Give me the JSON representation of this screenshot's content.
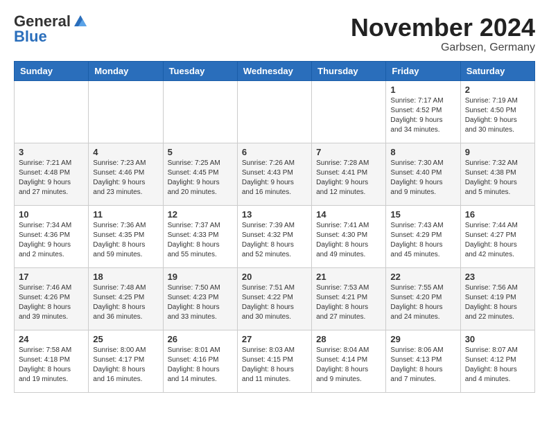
{
  "header": {
    "logo_general": "General",
    "logo_blue": "Blue",
    "month_title": "November 2024",
    "location": "Garbsen, Germany"
  },
  "weekdays": [
    "Sunday",
    "Monday",
    "Tuesday",
    "Wednesday",
    "Thursday",
    "Friday",
    "Saturday"
  ],
  "weeks": [
    [
      {
        "day": "",
        "info": ""
      },
      {
        "day": "",
        "info": ""
      },
      {
        "day": "",
        "info": ""
      },
      {
        "day": "",
        "info": ""
      },
      {
        "day": "",
        "info": ""
      },
      {
        "day": "1",
        "info": "Sunrise: 7:17 AM\nSunset: 4:52 PM\nDaylight: 9 hours and 34 minutes."
      },
      {
        "day": "2",
        "info": "Sunrise: 7:19 AM\nSunset: 4:50 PM\nDaylight: 9 hours and 30 minutes."
      }
    ],
    [
      {
        "day": "3",
        "info": "Sunrise: 7:21 AM\nSunset: 4:48 PM\nDaylight: 9 hours and 27 minutes."
      },
      {
        "day": "4",
        "info": "Sunrise: 7:23 AM\nSunset: 4:46 PM\nDaylight: 9 hours and 23 minutes."
      },
      {
        "day": "5",
        "info": "Sunrise: 7:25 AM\nSunset: 4:45 PM\nDaylight: 9 hours and 20 minutes."
      },
      {
        "day": "6",
        "info": "Sunrise: 7:26 AM\nSunset: 4:43 PM\nDaylight: 9 hours and 16 minutes."
      },
      {
        "day": "7",
        "info": "Sunrise: 7:28 AM\nSunset: 4:41 PM\nDaylight: 9 hours and 12 minutes."
      },
      {
        "day": "8",
        "info": "Sunrise: 7:30 AM\nSunset: 4:40 PM\nDaylight: 9 hours and 9 minutes."
      },
      {
        "day": "9",
        "info": "Sunrise: 7:32 AM\nSunset: 4:38 PM\nDaylight: 9 hours and 5 minutes."
      }
    ],
    [
      {
        "day": "10",
        "info": "Sunrise: 7:34 AM\nSunset: 4:36 PM\nDaylight: 9 hours and 2 minutes."
      },
      {
        "day": "11",
        "info": "Sunrise: 7:36 AM\nSunset: 4:35 PM\nDaylight: 8 hours and 59 minutes."
      },
      {
        "day": "12",
        "info": "Sunrise: 7:37 AM\nSunset: 4:33 PM\nDaylight: 8 hours and 55 minutes."
      },
      {
        "day": "13",
        "info": "Sunrise: 7:39 AM\nSunset: 4:32 PM\nDaylight: 8 hours and 52 minutes."
      },
      {
        "day": "14",
        "info": "Sunrise: 7:41 AM\nSunset: 4:30 PM\nDaylight: 8 hours and 49 minutes."
      },
      {
        "day": "15",
        "info": "Sunrise: 7:43 AM\nSunset: 4:29 PM\nDaylight: 8 hours and 45 minutes."
      },
      {
        "day": "16",
        "info": "Sunrise: 7:44 AM\nSunset: 4:27 PM\nDaylight: 8 hours and 42 minutes."
      }
    ],
    [
      {
        "day": "17",
        "info": "Sunrise: 7:46 AM\nSunset: 4:26 PM\nDaylight: 8 hours and 39 minutes."
      },
      {
        "day": "18",
        "info": "Sunrise: 7:48 AM\nSunset: 4:25 PM\nDaylight: 8 hours and 36 minutes."
      },
      {
        "day": "19",
        "info": "Sunrise: 7:50 AM\nSunset: 4:23 PM\nDaylight: 8 hours and 33 minutes."
      },
      {
        "day": "20",
        "info": "Sunrise: 7:51 AM\nSunset: 4:22 PM\nDaylight: 8 hours and 30 minutes."
      },
      {
        "day": "21",
        "info": "Sunrise: 7:53 AM\nSunset: 4:21 PM\nDaylight: 8 hours and 27 minutes."
      },
      {
        "day": "22",
        "info": "Sunrise: 7:55 AM\nSunset: 4:20 PM\nDaylight: 8 hours and 24 minutes."
      },
      {
        "day": "23",
        "info": "Sunrise: 7:56 AM\nSunset: 4:19 PM\nDaylight: 8 hours and 22 minutes."
      }
    ],
    [
      {
        "day": "24",
        "info": "Sunrise: 7:58 AM\nSunset: 4:18 PM\nDaylight: 8 hours and 19 minutes."
      },
      {
        "day": "25",
        "info": "Sunrise: 8:00 AM\nSunset: 4:17 PM\nDaylight: 8 hours and 16 minutes."
      },
      {
        "day": "26",
        "info": "Sunrise: 8:01 AM\nSunset: 4:16 PM\nDaylight: 8 hours and 14 minutes."
      },
      {
        "day": "27",
        "info": "Sunrise: 8:03 AM\nSunset: 4:15 PM\nDaylight: 8 hours and 11 minutes."
      },
      {
        "day": "28",
        "info": "Sunrise: 8:04 AM\nSunset: 4:14 PM\nDaylight: 8 hours and 9 minutes."
      },
      {
        "day": "29",
        "info": "Sunrise: 8:06 AM\nSunset: 4:13 PM\nDaylight: 8 hours and 7 minutes."
      },
      {
        "day": "30",
        "info": "Sunrise: 8:07 AM\nSunset: 4:12 PM\nDaylight: 8 hours and 4 minutes."
      }
    ]
  ]
}
